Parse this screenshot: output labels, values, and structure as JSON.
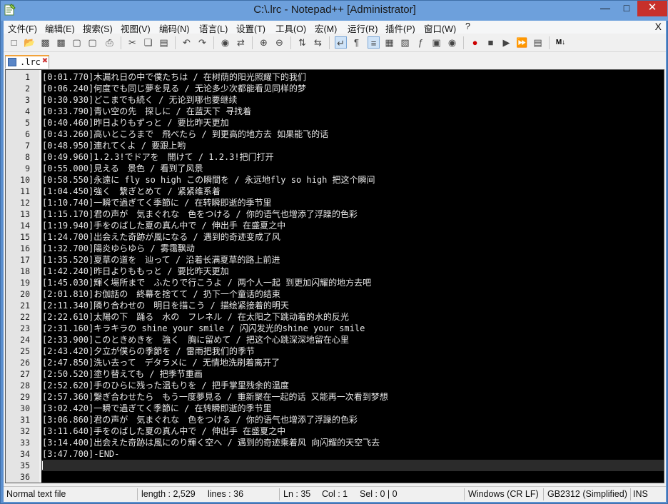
{
  "window": {
    "title": "C:\\.lrc - Notepad++ [Administrator]",
    "min_label": "—",
    "max_label": "□",
    "close_label": "✕"
  },
  "menu": {
    "items": [
      "文件(F)",
      "编辑(E)",
      "搜索(S)",
      "视图(V)",
      "编码(N)",
      "语言(L)",
      "设置(T)",
      "工具(O)",
      "宏(M)",
      "运行(R)",
      "插件(P)",
      "窗口(W)",
      "?"
    ],
    "close_doc": "X"
  },
  "tab": {
    "label": ".lrc",
    "icon": "save-disk-icon",
    "close_icon": "tab-close-icon"
  },
  "editor": {
    "lines": [
      {
        "n": "1",
        "text": "[0:01.770]木漏れ日の中で僕たちは / 在树荫的阳光照耀下的我们"
      },
      {
        "n": "2",
        "text": "[0:06.240]何度でも同じ夢を見る / 无论多少次都能看见同样的梦"
      },
      {
        "n": "3",
        "text": "[0:30.930]どこまでも続く / 无论到哪也要继续"
      },
      {
        "n": "4",
        "text": "[0:33.790]青い空の先　探しに / 在蓝天下 寻找着"
      },
      {
        "n": "5",
        "text": "[0:40.460]昨日よりもずっと / 要比昨天更加"
      },
      {
        "n": "6",
        "text": "[0:43.260]高いところまで　飛べたら / 到更高的地方去 如果能飞的话"
      },
      {
        "n": "7",
        "text": "[0:48.950]連れてくよ / 要跟上哟"
      },
      {
        "n": "8",
        "text": "[0:49.960]1.2.3!でドアを　開けて / 1.2.3!把门打开"
      },
      {
        "n": "9",
        "text": "[0:55.000]見える　景色 / 看到了风景"
      },
      {
        "n": "10",
        "text": "[0:58.550]永遠に fly so high この瞬間を / 永远地fly so high 把这个瞬间"
      },
      {
        "n": "11",
        "text": "[1:04.450]強く　繋ぎとめて / 紧紧维系着"
      },
      {
        "n": "12",
        "text": "[1:10.740]一瞬で過ぎてく季節に / 在转瞬即逝的季节里"
      },
      {
        "n": "13",
        "text": "[1:15.170]君の声が　気まぐれな　色をつける / 你的语气也增添了浮躁的色彩"
      },
      {
        "n": "14",
        "text": "[1:19.940]手をのばした夏の真ん中で / 伸出手 在盛夏之中"
      },
      {
        "n": "15",
        "text": "[1:24.700]出会えた奇跡が風になる / 遇到的奇迹变成了风"
      },
      {
        "n": "16",
        "text": "[1:32.700]陽炎ゆらゆら / 雾霭飘动"
      },
      {
        "n": "17",
        "text": "[1:35.520]夏草の道を　辿って / 沿着长满夏草的路上前进"
      },
      {
        "n": "18",
        "text": "[1:42.240]昨日よりももっと / 要比昨天更加"
      },
      {
        "n": "19",
        "text": "[1:45.030]輝く場所まで　ふたりで行こうよ / 两个人一起 到更加闪耀的地方去吧"
      },
      {
        "n": "20",
        "text": "[2:01.810]お伽話の　終幕を捨てて / 扔下一个童话的结束"
      },
      {
        "n": "21",
        "text": "[2:11.340]隣り合わせの　明日を描こう / 描绘紧接着的明天"
      },
      {
        "n": "22",
        "text": "[2:22.610]太陽の下　踊る　水の　フレネル / 在太阳之下跳动着的水的反光"
      },
      {
        "n": "23",
        "text": "[2:31.160]キラキラの shine your smile / 闪闪发光的shine your smile"
      },
      {
        "n": "24",
        "text": "[2:33.900]このときめきを　強く　胸に留めて / 把这个心跳深深地留在心里"
      },
      {
        "n": "25",
        "text": "[2:43.420]夕立が僕らの季節を / 雷雨把我们的季节"
      },
      {
        "n": "26",
        "text": "[2:47.850]洗い去って　デタラメに / 无情地洗刷着离开了"
      },
      {
        "n": "27",
        "text": "[2:50.520]塗り替えても / 把季节重画"
      },
      {
        "n": "28",
        "text": "[2:52.620]手のひらに残った温もりを / 把手掌里残余的温度"
      },
      {
        "n": "29",
        "text": "[2:57.360]繋ぎ合わせたら　もう一度夢見る / 重新聚在一起的话 又能再一次看到梦想"
      },
      {
        "n": "30",
        "text": "[3:02.420]一瞬で過ぎてく季節に / 在转瞬即逝的季节里"
      },
      {
        "n": "31",
        "text": "[3:06.860]君の声が　気まぐれな　色をつける / 你的语气也增添了浮躁的色彩"
      },
      {
        "n": "32",
        "text": "[3:11.640]手をのばした夏の真ん中で / 伸出手 在盛夏之中"
      },
      {
        "n": "33",
        "text": "[3:14.400]出会えた奇跡は風にのり輝く空へ / 遇到的奇迹乘着风 向闪耀的天空飞去"
      },
      {
        "n": "34",
        "text": "[3:47.700]-END-"
      },
      {
        "n": "35",
        "text": ""
      },
      {
        "n": "36",
        "text": ""
      }
    ]
  },
  "status": {
    "type": "Normal text file",
    "length": "length : 2,529",
    "lines": "lines : 36",
    "ln": "Ln : 35",
    "col": "Col : 1",
    "sel": "Sel : 0 | 0",
    "eol": "Windows (CR LF)",
    "encoding": "GB2312 (Simplified)",
    "mode": "INS"
  },
  "colors": {
    "editor_bg": "#000000",
    "editor_fg": "#e8e8e8",
    "gutter_bg": "#e4e4e4",
    "title_bg": "#6da0dc",
    "close_btn": "#c7302b",
    "tab_accent": "#f2a23a"
  }
}
